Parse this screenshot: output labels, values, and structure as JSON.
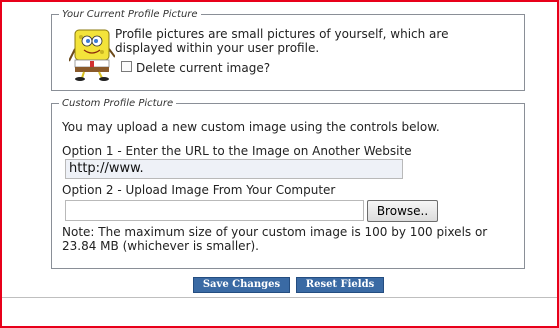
{
  "current_picture": {
    "legend": "Your Current Profile Picture",
    "description": "Profile pictures are small pictures of yourself, which are displayed within your user profile.",
    "delete_label": "Delete current image?"
  },
  "custom_picture": {
    "legend": "Custom Profile Picture",
    "instructions": "You may upload a new custom image using the controls below.",
    "option1_label": "Option 1 - Enter the URL to the Image on Another Website",
    "url_value": "http://www.",
    "option2_label": "Option 2 - Upload Image From Your Computer",
    "browse_label": "Browse..",
    "note": "Note: The maximum size of your custom image is 100 by 100 pixels or 23.84 MB (whichever is smaller)."
  },
  "actions": {
    "save_label": "Save Changes",
    "reset_label": "Reset Fields"
  },
  "colors": {
    "frame_border": "#e8001a",
    "button_bg": "#3a6aa4"
  },
  "icons": {
    "avatar": "spongebob-avatar-image"
  }
}
